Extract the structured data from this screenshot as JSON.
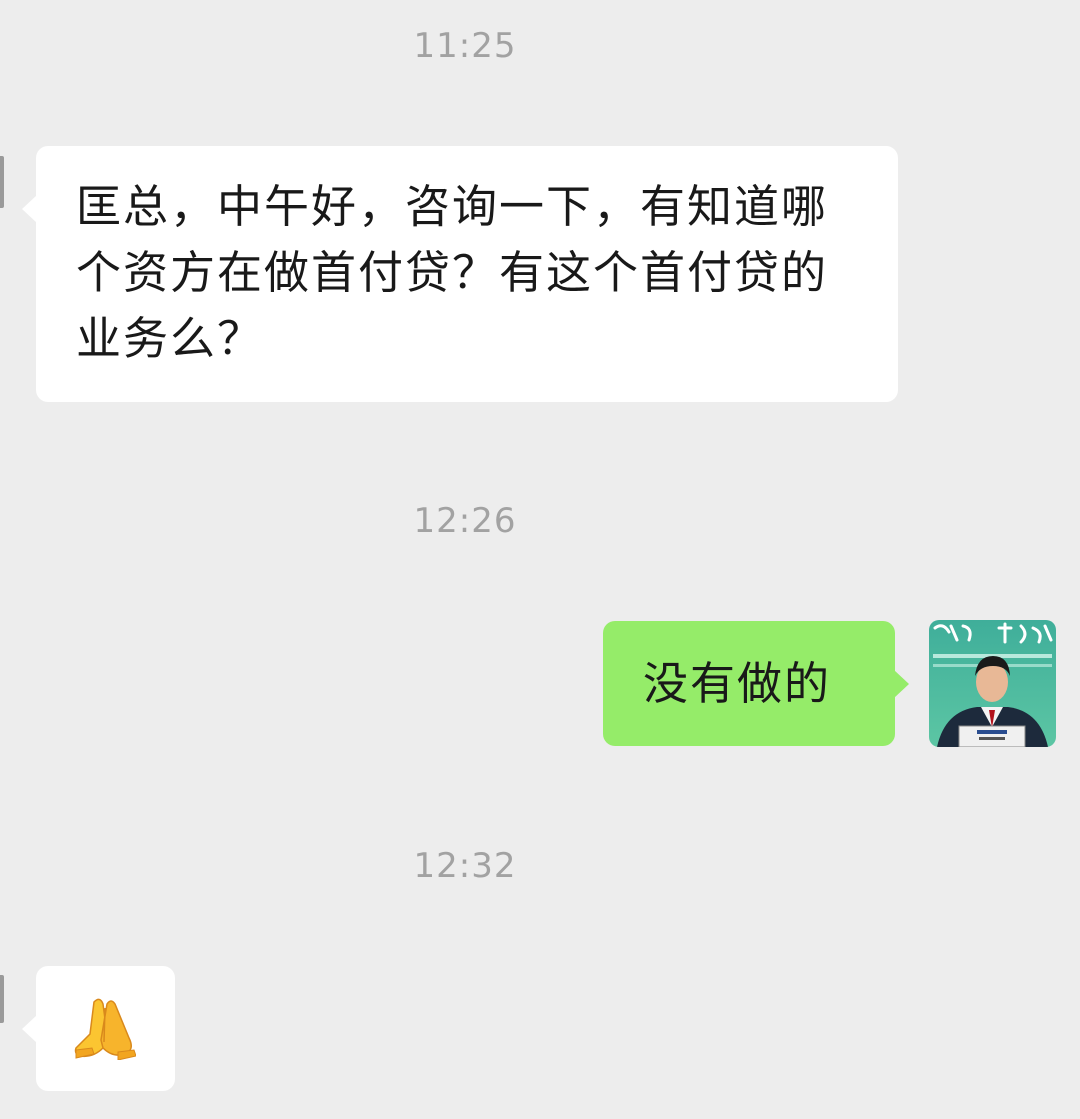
{
  "chat": {
    "messages": [
      {
        "timestamp": "11:25",
        "direction": "incoming",
        "text": "匡总，中午好，咨询一下，有知道哪个资方在做首付贷？有这个首付贷的业务么？"
      },
      {
        "timestamp": "12:26",
        "direction": "outgoing",
        "text": "没有做的"
      },
      {
        "timestamp": "12:32",
        "direction": "incoming",
        "emoji": "folded-hands-icon"
      }
    ]
  },
  "colors": {
    "background": "#ededed",
    "incoming_bubble": "#ffffff",
    "outgoing_bubble": "#95ec69",
    "timestamp_text": "#a2a2a2",
    "message_text": "#191919"
  }
}
